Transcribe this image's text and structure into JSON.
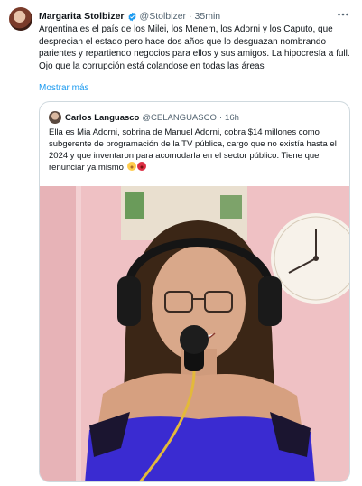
{
  "tweet": {
    "author_name": "Margarita Stolbizer",
    "author_handle": "@Stolbizer",
    "separator": "·",
    "time": "35min",
    "text_lines": [
      "Argentina es el país de los Milei, los Menem, los Adorni y los Caputo, que desprecian el estado pero hace dos años que lo desguazan nombrando parientes y repartiendo negocios para ellos y sus amigos. La hipocresía a full.",
      "Ojo que la corrupción está colandose en todas las áreas"
    ],
    "show_more_label": "Mostrar más",
    "verified_color": "#1d9bf0"
  },
  "quote": {
    "author_name": "Carlos Languasco",
    "author_handle": "@CELANGUASCO",
    "separator": "·",
    "time": "16h",
    "text": "Ella es Mia Adorni, sobrina de Manuel Adorni, cobra $14 millones como subgerente de programación de la TV pública, cargo que no existía hasta el 2024 y que inventaron para acomodarla en el sector público. Tiene que renunciar ya mismo",
    "emojis": [
      "smiling-face-emoji",
      "angry-face-emoji"
    ]
  },
  "colors": {
    "link": "#1d9bf0",
    "secondary_text": "#536471",
    "border": "#cfd9de"
  }
}
